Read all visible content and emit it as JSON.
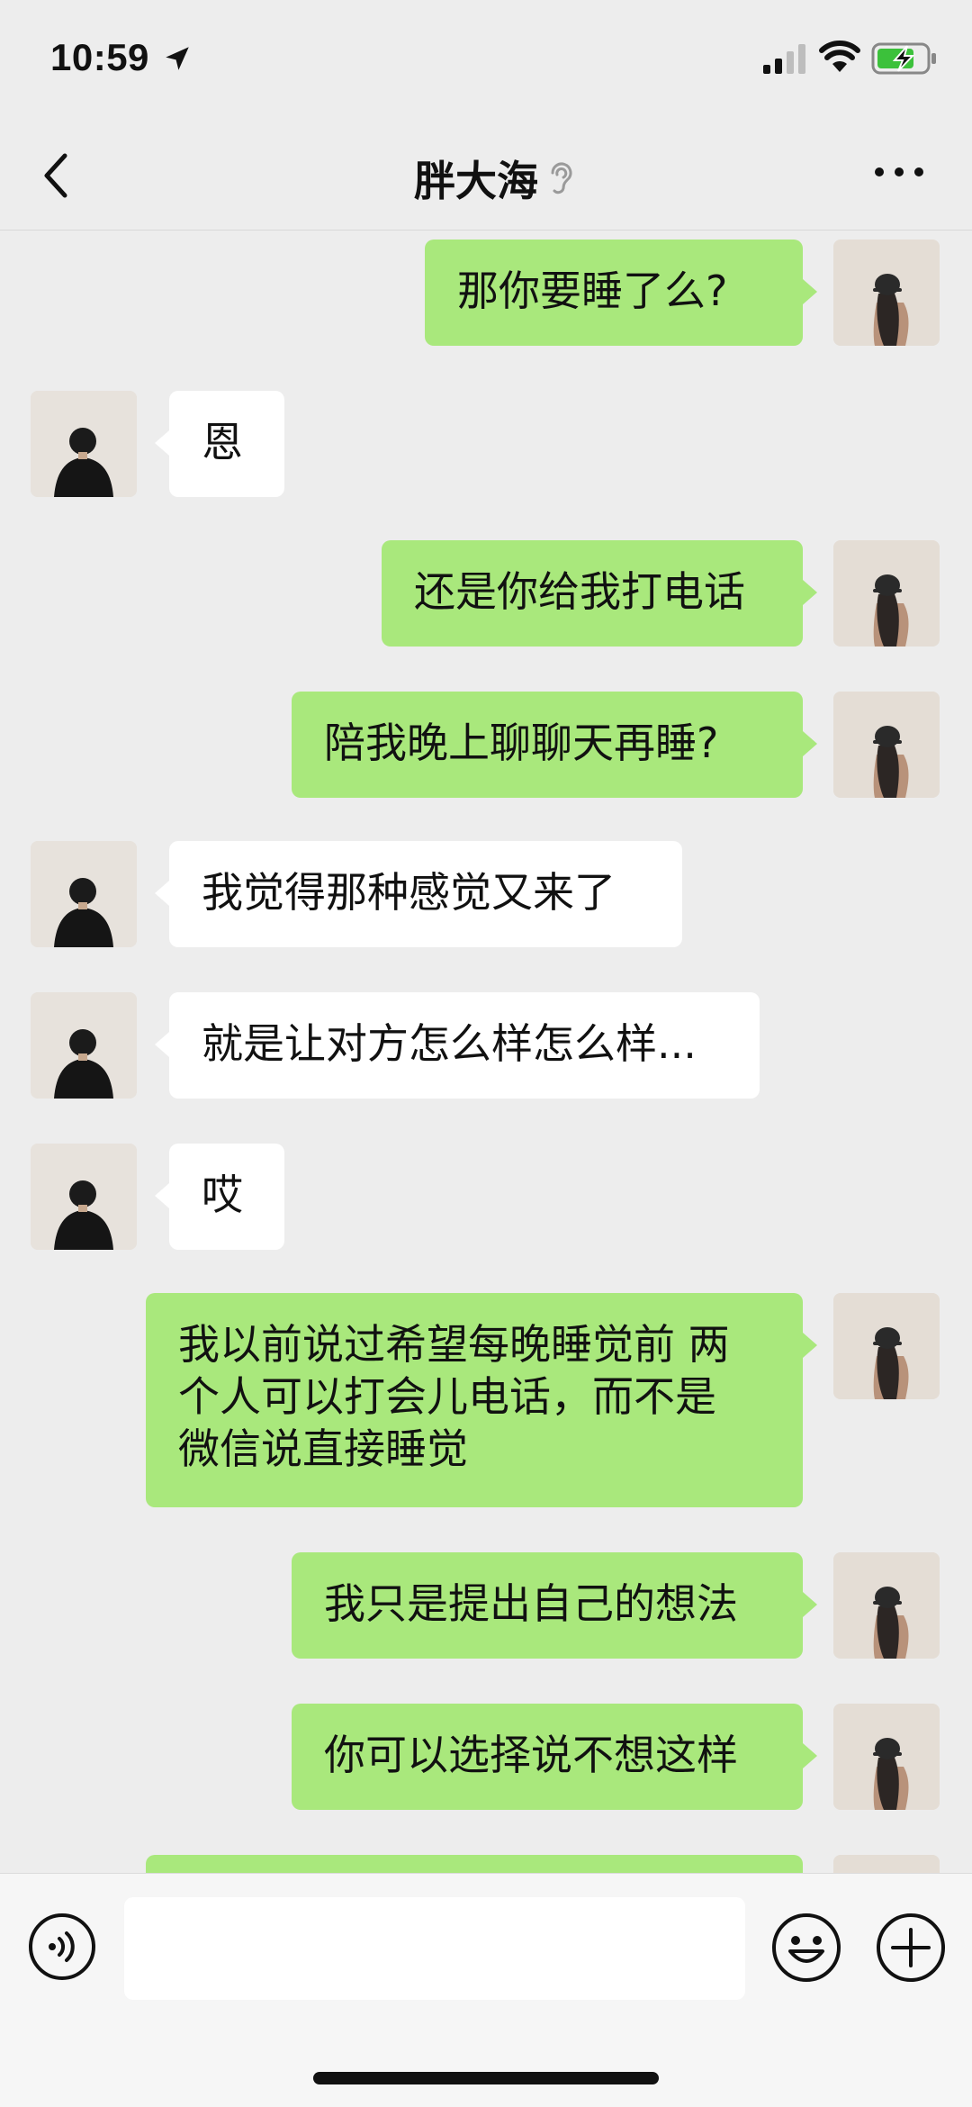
{
  "status": {
    "time": "10:59"
  },
  "header": {
    "title": "胖大海"
  },
  "messages": [
    {
      "side": "right",
      "text": "那你要睡了么?"
    },
    {
      "side": "left",
      "text": "恩"
    },
    {
      "side": "right",
      "text": "还是你给我打电话"
    },
    {
      "side": "right",
      "text": "陪我晚上聊聊天再睡?"
    },
    {
      "side": "left",
      "text": "我觉得那种感觉又来了"
    },
    {
      "side": "left",
      "text": "就是让对方怎么样怎么样..."
    },
    {
      "side": "left",
      "text": "哎"
    },
    {
      "side": "right",
      "text": "我以前说过希望每晚睡觉前 两\n个人可以打会儿电话，而不是\n微信说直接睡觉"
    },
    {
      "side": "right",
      "text": "我只是提出自己的想法"
    },
    {
      "side": "right",
      "text": "你可以选择说不想这样"
    },
    {
      "side": "right",
      "text": ""
    }
  ],
  "input": {
    "value": ""
  },
  "colors": {
    "bubble_self": "#a9e87c",
    "bubble_other": "#ffffff",
    "background": "#ededed"
  },
  "icons": [
    "back-icon",
    "ear-icon",
    "more-icon",
    "voice-icon",
    "emoji-icon",
    "plus-icon"
  ]
}
